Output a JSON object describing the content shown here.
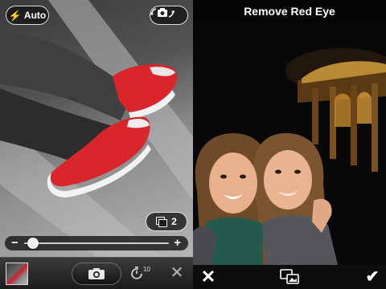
{
  "camera": {
    "flash": {
      "icon": "lightning-bolt-icon",
      "mode_label": "Auto"
    },
    "switch_camera": {
      "icon": "rotate-camera-icon"
    },
    "burst": {
      "icon": "stacked-frames-icon",
      "count": "2"
    },
    "zoom": {
      "minus_label": "−",
      "plus_label": "+",
      "level": 0.06
    },
    "toolbar": {
      "thumbnail": "last-photo-thumbnail",
      "shutter_icon": "camera-icon",
      "timer": {
        "icon": "timer-icon",
        "label": "10"
      },
      "close_label": "✕"
    }
  },
  "editor": {
    "title": "Remove Red Eye",
    "toolbar": {
      "cancel_label": "✕",
      "compare_icon": "compare-images-icon",
      "done_label": "✔"
    }
  },
  "colors": {
    "shoe_red": "#d8262b",
    "toolbar_dark": "#1c1c1c",
    "title_white": "#ffffff"
  }
}
